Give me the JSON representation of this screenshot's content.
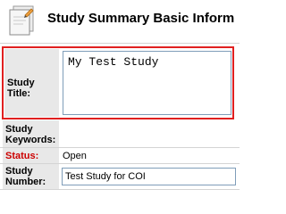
{
  "header": {
    "title": "Study Summary Basic Inform",
    "icon": "documents-icon"
  },
  "form": {
    "study_title": {
      "label": "Study Title:",
      "value": "My Test Study"
    },
    "study_keywords": {
      "label": "Study Keywords:",
      "value": ""
    },
    "status": {
      "label": "Status:",
      "value": "Open",
      "label_color": "#cc0000"
    },
    "study_number": {
      "label": "Study Number:",
      "value": "Test Study for COI"
    }
  },
  "colors": {
    "highlight_border": "#e02020",
    "label_bg": "#e8e8e8"
  }
}
